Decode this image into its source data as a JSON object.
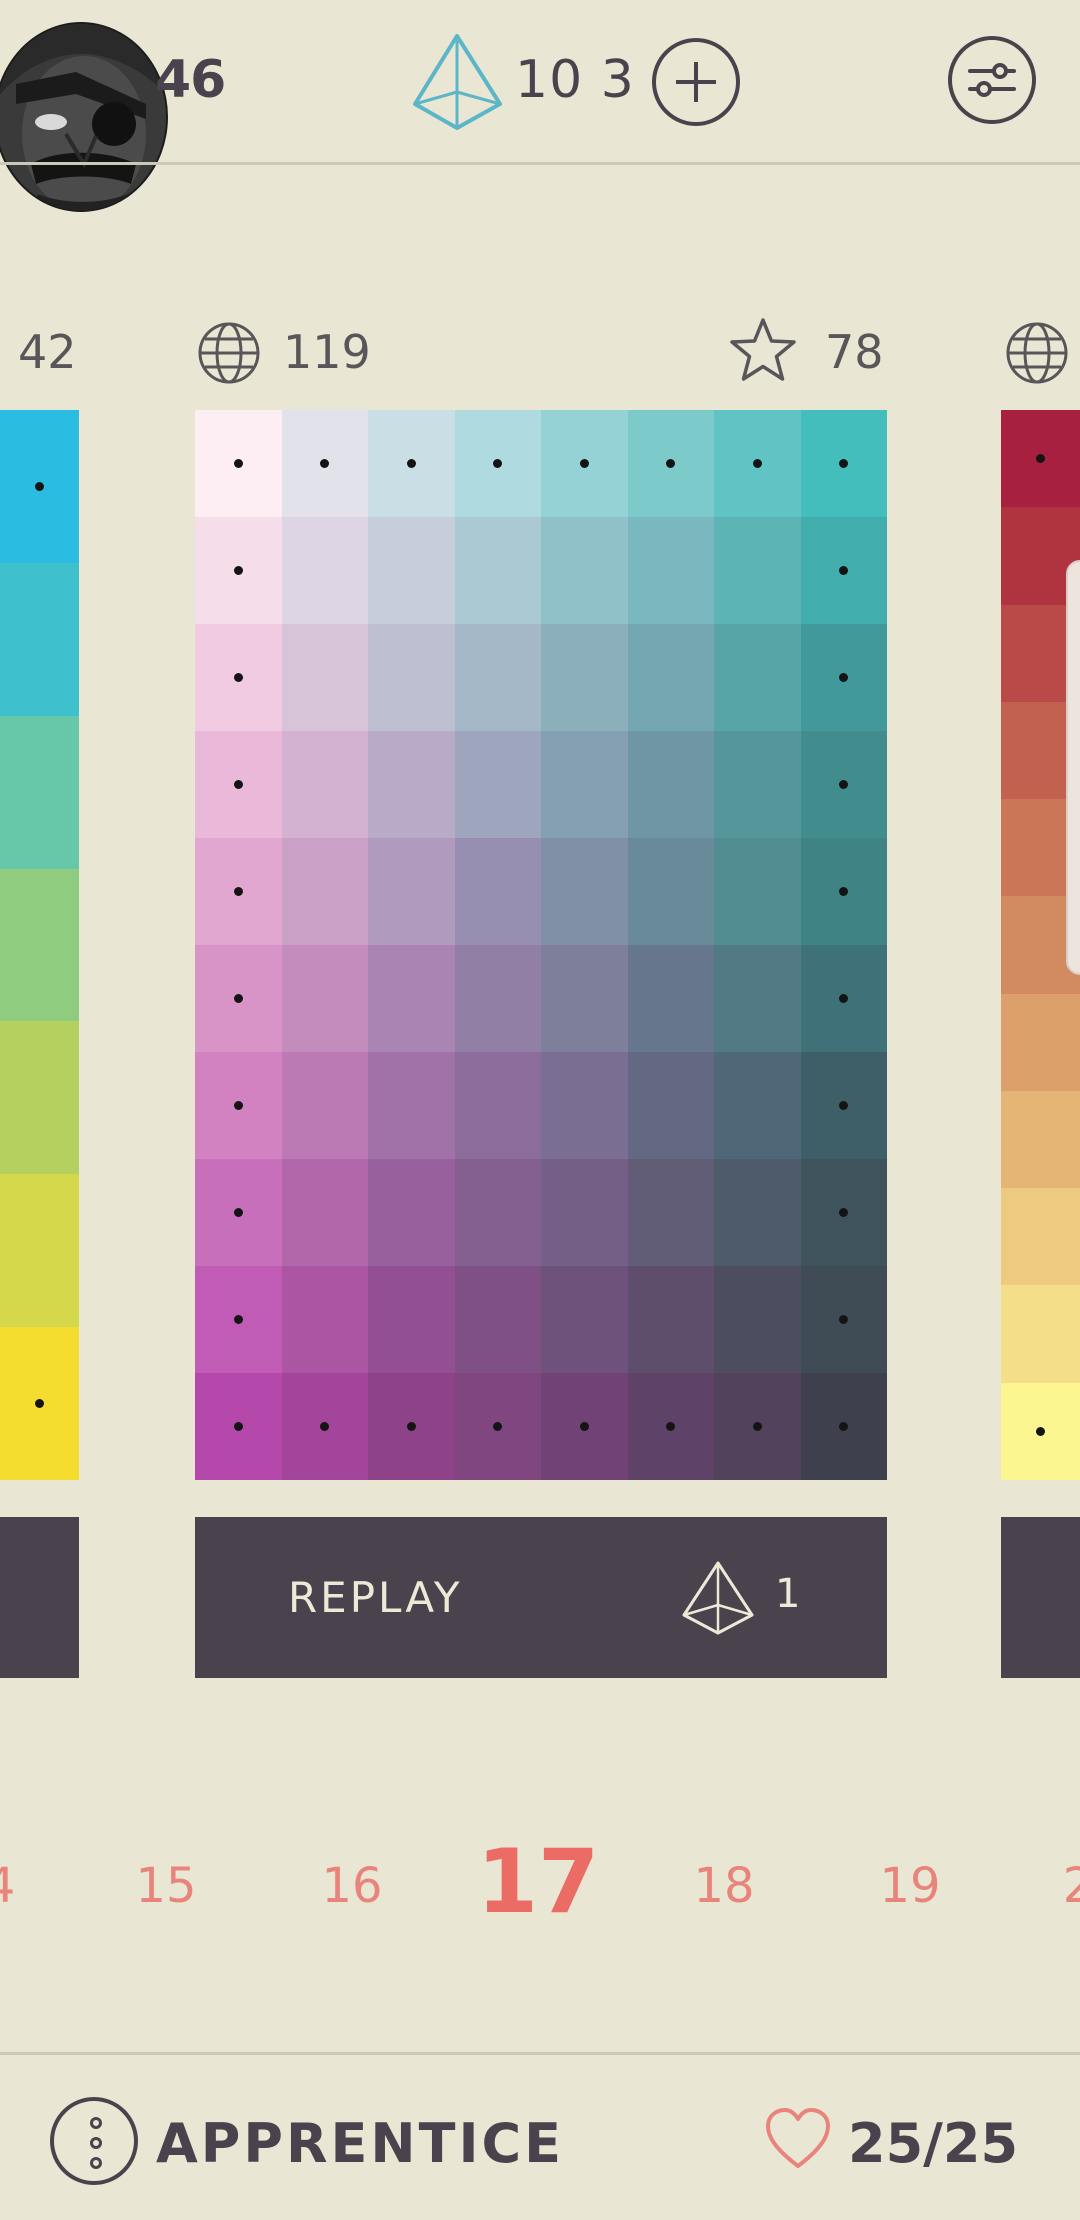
{
  "header": {
    "score": "46",
    "gems": "10 3",
    "add_icon": "plus-circle-icon",
    "settings_icon": "sliders-icon",
    "accent_color": "#5BB6C8"
  },
  "cards": {
    "left_count": "42",
    "main": {
      "plays": "119",
      "rating": "78",
      "replay_label": "REPLAY",
      "replay_cost": "1"
    }
  },
  "main_grid": {
    "rows": 10,
    "cols": 8,
    "colors": [
      [
        "#FCEEF2",
        "#E2E2EA",
        "#C9DFE5",
        "#AFDAE0",
        "#95D2D5",
        "#7CCAC9",
        "#5FC4C3",
        "#43BEBD"
      ],
      [
        "#F6DDEA",
        "#DDD5E3",
        "#C6CEDB",
        "#ABC9D3",
        "#91C1C8",
        "#78B8BE",
        "#5DB4B4",
        "#42ADAD"
      ],
      [
        "#F0CBE2",
        "#D8C4D9",
        "#BFBFD2",
        "#A5B8C8",
        "#8BB0BC",
        "#74A7B1",
        "#58A5A6",
        "#42999B"
      ],
      [
        "#EAB9D9",
        "#D2B2D0",
        "#B8ABC8",
        "#9EA6BD",
        "#85A0B2",
        "#6F96A4",
        "#54969A",
        "#418D8E"
      ],
      [
        "#E2A7D0",
        "#CAA0C6",
        "#B09ABD",
        "#978FB1",
        "#8090A6",
        "#698A98",
        "#528D91",
        "#3F8385"
      ],
      [
        "#D994C7",
        "#C38CBC",
        "#AA84B2",
        "#917FA5",
        "#7D7F9B",
        "#66778D",
        "#517A84",
        "#3E7278"
      ],
      [
        "#D281C1",
        "#BB7AB3",
        "#A172A7",
        "#8B6C9B",
        "#7A6E93",
        "#636982",
        "#4F6877",
        "#3E5E68"
      ],
      [
        "#C86FBB",
        "#B267AB",
        "#99609E",
        "#846090",
        "#745F87",
        "#625D77",
        "#4E5B6B",
        "#3F535D"
      ],
      [
        "#C05CB5",
        "#AC55A3",
        "#924F93",
        "#7F5086",
        "#6E527C",
        "#5E4E6B",
        "#4D4D60",
        "#3F4B55"
      ],
      [
        "#B449AB",
        "#A2459B",
        "#8E4389",
        "#7F467F",
        "#704276",
        "#5F4268",
        "#52425C",
        "#3E414D"
      ]
    ],
    "fixed_cells": [
      [
        0,
        0
      ],
      [
        0,
        1
      ],
      [
        0,
        2
      ],
      [
        0,
        3
      ],
      [
        0,
        4
      ],
      [
        0,
        5
      ],
      [
        0,
        6
      ],
      [
        0,
        7
      ],
      [
        1,
        0
      ],
      [
        1,
        7
      ],
      [
        2,
        0
      ],
      [
        2,
        7
      ],
      [
        3,
        0
      ],
      [
        3,
        7
      ],
      [
        4,
        0
      ],
      [
        4,
        7
      ],
      [
        5,
        0
      ],
      [
        5,
        7
      ],
      [
        6,
        0
      ],
      [
        6,
        7
      ],
      [
        7,
        0
      ],
      [
        7,
        7
      ],
      [
        8,
        0
      ],
      [
        8,
        7
      ],
      [
        9,
        0
      ],
      [
        9,
        1
      ],
      [
        9,
        2
      ],
      [
        9,
        3
      ],
      [
        9,
        4
      ],
      [
        9,
        5
      ],
      [
        9,
        6
      ],
      [
        9,
        7
      ]
    ]
  },
  "left_strip": {
    "colors": [
      "#2BBCE1",
      "#3EC1CC",
      "#66C7A9",
      "#8FCC80",
      "#B4D160",
      "#D5D84B",
      "#F4DD2E"
    ],
    "fixed_cells": [
      0,
      6
    ]
  },
  "right_strip": {
    "colors": [
      "#A8203F",
      "#B0343F",
      "#BA4A48",
      "#C2614F",
      "#CA7657",
      "#D28B61",
      "#DCA06A",
      "#E5B575",
      "#EDCA80",
      "#F4DE8A",
      "#FCF691"
    ],
    "fixed_cells": [
      0,
      10
    ]
  },
  "level_picker": {
    "items": [
      "4",
      "15",
      "16",
      "17",
      "18",
      "19",
      "2"
    ],
    "current": "17"
  },
  "footer": {
    "rank": "APPRENTICE",
    "lives": "25/25",
    "heart_color": "#E8847C"
  }
}
